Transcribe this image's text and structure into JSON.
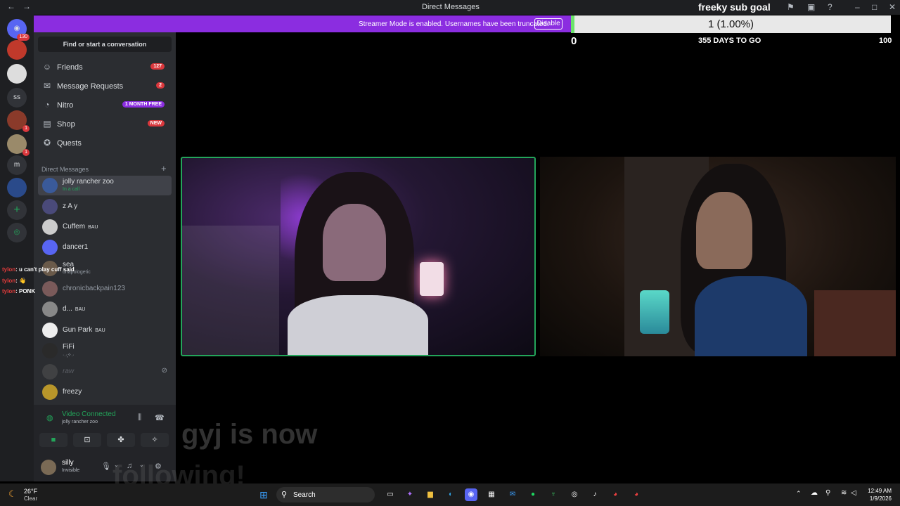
{
  "window": {
    "title": "Direct Messages",
    "back": "←",
    "forward": "→"
  },
  "banner": {
    "text": "Streamer Mode is enabled. Usernames have been truncated.",
    "button": "Disable"
  },
  "goal": {
    "title": "freeky sub goal",
    "progress_text": "1 (1.00%)",
    "progress": 0.01,
    "min": "0",
    "days": "355 DAYS TO GO",
    "max": "100"
  },
  "rail": {
    "home_badge": "130",
    "items": [
      "ss",
      "m"
    ],
    "badges": [
      "1",
      "1"
    ]
  },
  "sidebar": {
    "find": "Find or start a conversation",
    "nav": [
      {
        "label": "Friends",
        "badge": "127"
      },
      {
        "label": "Message Requests",
        "badge": "2"
      },
      {
        "label": "Nitro",
        "badge": "1 MONTH FREE"
      },
      {
        "label": "Shop",
        "badge": "NEW"
      },
      {
        "label": "Quests",
        "badge": ""
      }
    ],
    "dm_header": "Direct Messages",
    "dms": [
      {
        "name": "jolly rancher zoo",
        "sub": "In a call",
        "tag": ""
      },
      {
        "name": "z A y",
        "sub": "",
        "tag": ""
      },
      {
        "name": "Cuffem",
        "sub": "",
        "tag": "BAU"
      },
      {
        "name": "dancer1",
        "sub": "",
        "tag": ""
      },
      {
        "name": "sea",
        "sub": "unapologetic",
        "tag": ""
      },
      {
        "name": "chronicbackpain123",
        "sub": "",
        "tag": ""
      },
      {
        "name": "d...",
        "sub": "",
        "tag": "BAU"
      },
      {
        "name": "Gun Park",
        "sub": "",
        "tag": "BAU"
      },
      {
        "name": "FiFi",
        "sub": "·.·̩͙✧.·",
        "tag": ""
      },
      {
        "name": "raw",
        "sub": "",
        "tag": ""
      },
      {
        "name": "freezy",
        "sub": "",
        "tag": ""
      }
    ]
  },
  "voice": {
    "status": "Video Connected",
    "channel": "jolly rancher zoo"
  },
  "user": {
    "name": "silly",
    "status": "Invisible"
  },
  "chat": [
    {
      "user": "tylon",
      "text": ": u can't play cuff said"
    },
    {
      "user": "tylon",
      "text": ": 👋"
    },
    {
      "user": "tylon",
      "text": ": PONK"
    }
  ],
  "alert": {
    "line1": "gyj is now",
    "line2": "following!"
  },
  "taskbar": {
    "temp": "26°F",
    "condition": "Clear",
    "search": "Search",
    "time": "12:49 AM",
    "date": "1/9/2026"
  },
  "colors": {
    "accent": "#8b2de0",
    "online": "#23a55a",
    "badge": "#da373c",
    "goal_fill": "#6be36b"
  }
}
